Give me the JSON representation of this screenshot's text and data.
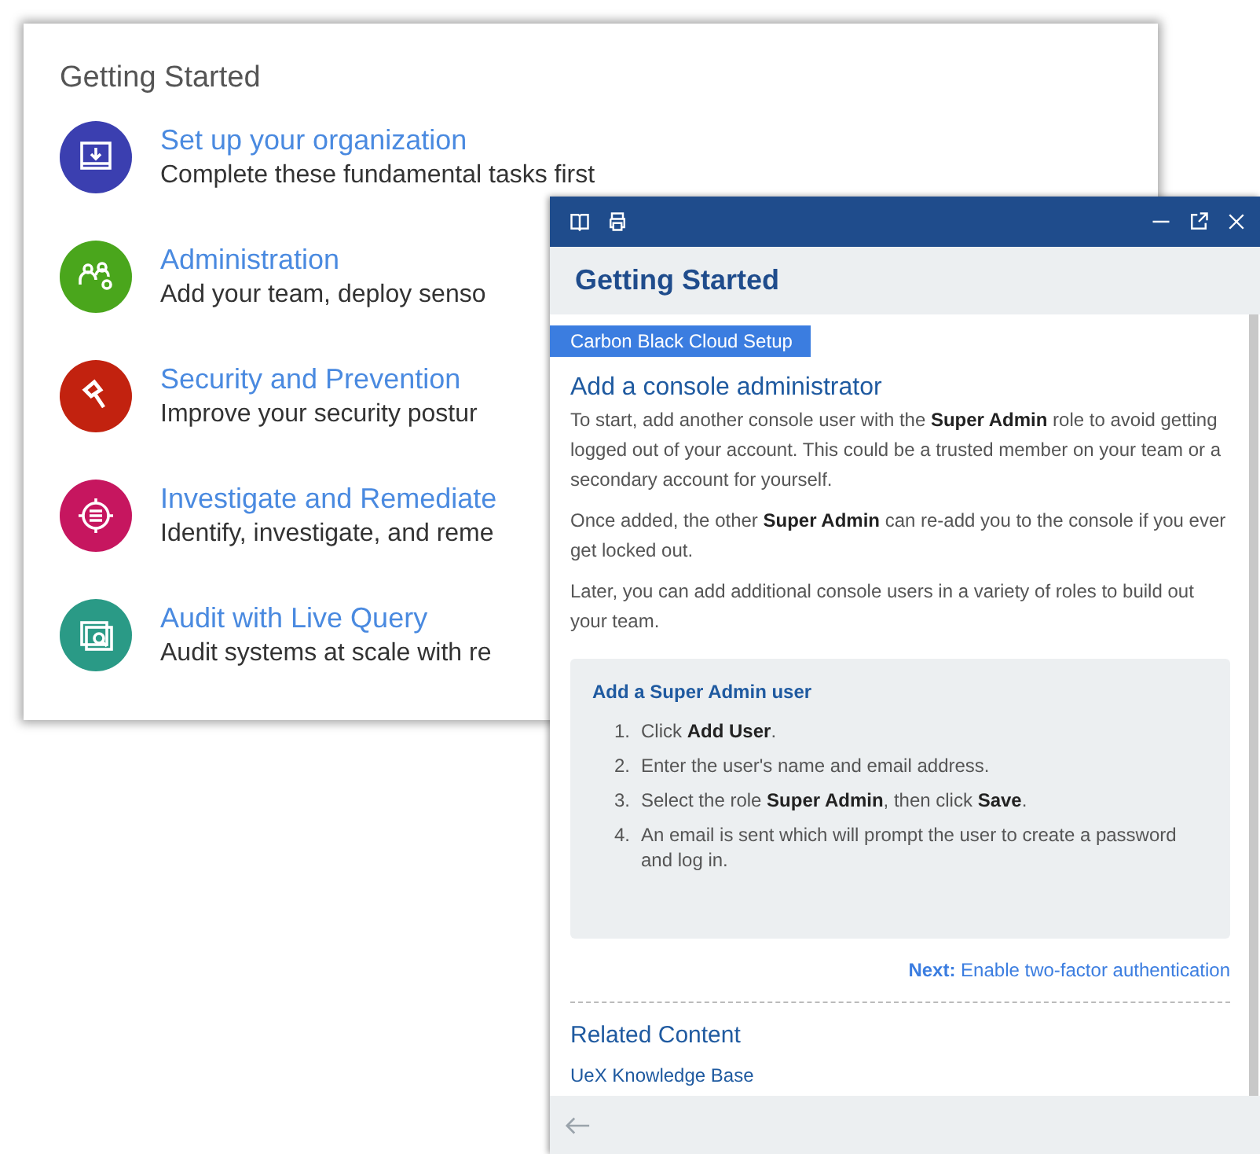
{
  "card": {
    "title": "Getting Started",
    "items": [
      {
        "kind": "setup",
        "color": "#3b3fb0",
        "title": "Set up your organization",
        "description": "Complete these fundamental tasks first"
      },
      {
        "kind": "admin",
        "color": "#4aa61c",
        "title": "Administration",
        "description": "Add your team, deploy senso"
      },
      {
        "kind": "security",
        "color": "#c2220f",
        "title": "Security and Prevention",
        "description": "Improve your security postur"
      },
      {
        "kind": "investigate",
        "color": "#c6165f",
        "title": "Investigate and Remediate",
        "description": "Identify, investigate, and reme"
      },
      {
        "kind": "audit",
        "color": "#2a9a86",
        "title": "Audit with Live Query",
        "description": "Audit systems at scale with re"
      }
    ]
  },
  "panel": {
    "title": "Getting Started",
    "tab": "Carbon Black Cloud Setup",
    "heading": "Add a console administrator",
    "paragraphs": [
      "To start, add another console user with the **Super Admin** role to avoid getting logged out of your account. This could be a trusted member on your team or a secondary account for yourself.",
      "Once added, the other **Super Admin** can re-add you to the console if you ever get locked out.",
      "Later, you can add additional console users in a variety of roles to build out your team."
    ],
    "box": {
      "title": "Add a Super Admin user",
      "steps": [
        {
          "number": "1.",
          "text": "Click **Add User**."
        },
        {
          "number": "2.",
          "text": "Enter the user's name and email address."
        },
        {
          "number": "3.",
          "text": "Select the role **Super Admin**, then click **Save**."
        },
        {
          "number": "4.",
          "text": "An email is sent which will prompt the user to create a password and log in."
        }
      ]
    },
    "next": {
      "label": "Next:",
      "text": "Enable two-factor authentication"
    },
    "related": {
      "title": "Related Content",
      "links": [
        "UeX Knowledge Base"
      ]
    }
  }
}
